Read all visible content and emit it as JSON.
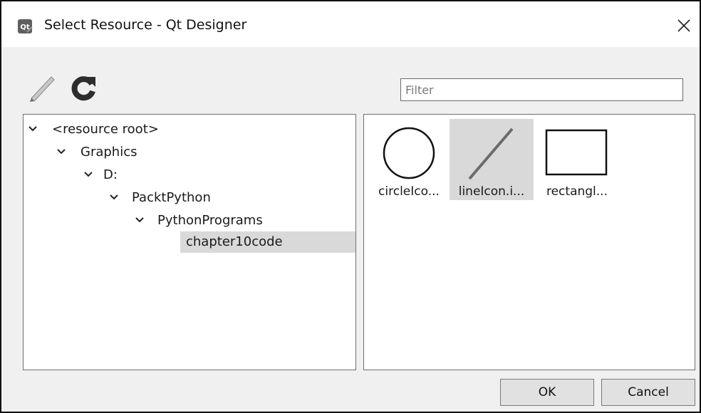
{
  "window": {
    "title": "Select Resource - Qt Designer",
    "app_icon": "qt-designer-icon",
    "close_icon": "close-icon"
  },
  "toolbar": {
    "edit_icon": "pencil-icon",
    "reload_icon": "reload-icon"
  },
  "filter": {
    "placeholder": "Filter",
    "value": ""
  },
  "tree": {
    "items": [
      {
        "label": "<resource root>",
        "expanded": true,
        "level": 0
      },
      {
        "label": "Graphics",
        "expanded": true,
        "level": 1
      },
      {
        "label": "D:",
        "expanded": true,
        "level": 2
      },
      {
        "label": "PacktPython",
        "expanded": true,
        "level": 3
      },
      {
        "label": "PythonPrograms",
        "expanded": true,
        "level": 4
      },
      {
        "label": "chapter10code",
        "expanded": false,
        "level": 5,
        "selected": true
      }
    ]
  },
  "resources": {
    "items": [
      {
        "label": "circleIco...",
        "icon": "circle-icon",
        "selected": false
      },
      {
        "label": "lineIcon.i...",
        "icon": "line-icon",
        "selected": true
      },
      {
        "label": "rectangl...",
        "icon": "rectangle-icon",
        "selected": false
      }
    ]
  },
  "buttons": {
    "ok": "OK",
    "cancel": "Cancel"
  },
  "colors": {
    "selection": "#d9d9d9",
    "reload_icon": "#2d2d2d"
  }
}
